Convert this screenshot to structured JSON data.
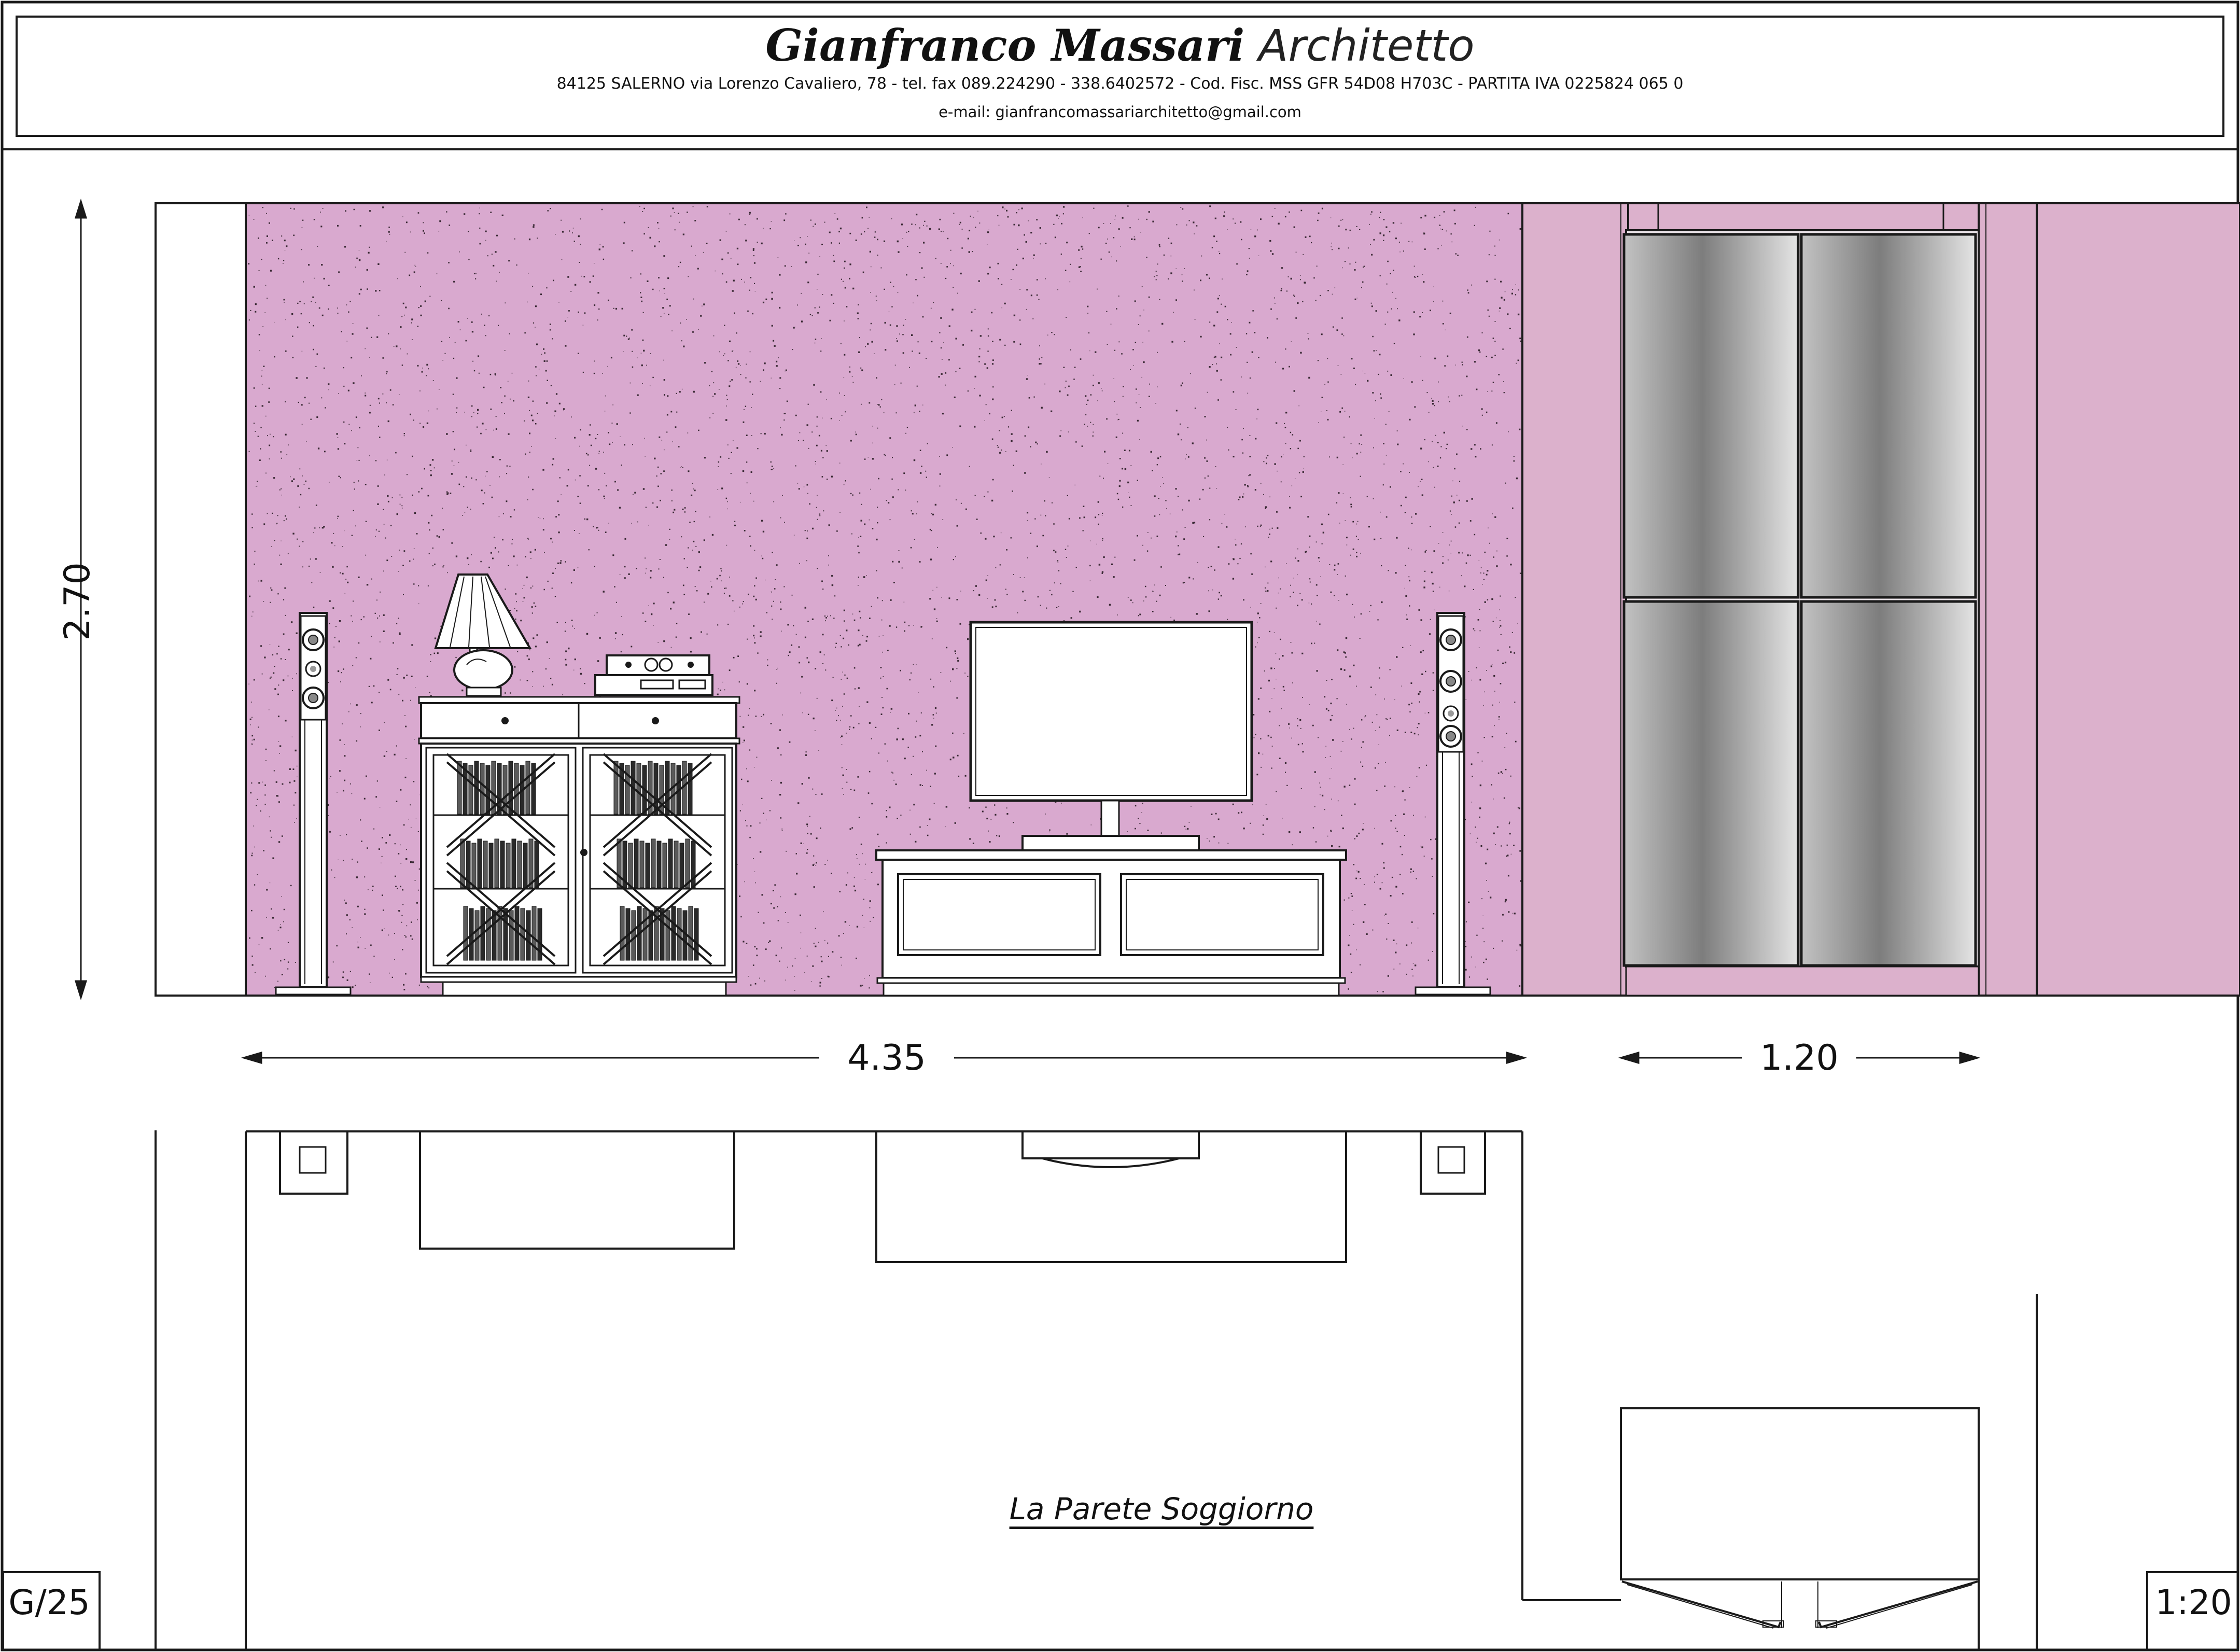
{
  "header": {
    "firm_name": "Gianfranco Massari",
    "firm_title": "Architetto",
    "address_line": "84125 SALERNO   via Lorenzo Cavaliero, 78  -  tel. fax 089.224290 - 338.6402572 -  Cod. Fisc. MSS GFR 54D08 H703C  -  PARTITA  IVA 0225824 065 0",
    "email_line": "e-mail: gianfrancomassariarchitetto@gmail.com"
  },
  "drawing": {
    "title": "La Parete Soggiorno",
    "sheet_number": "G/25",
    "scale": "1:20",
    "dimensions": {
      "wall_height": "2.70",
      "wall_width": "4.35",
      "wardrobe_width": "1.20"
    }
  },
  "colors": {
    "wall": "#d9a9cf",
    "alcove": "#dcb1cc",
    "stroke": "#1a1a1a",
    "glass_dark": "#7a7a7a",
    "glass_light": "#dedede"
  }
}
